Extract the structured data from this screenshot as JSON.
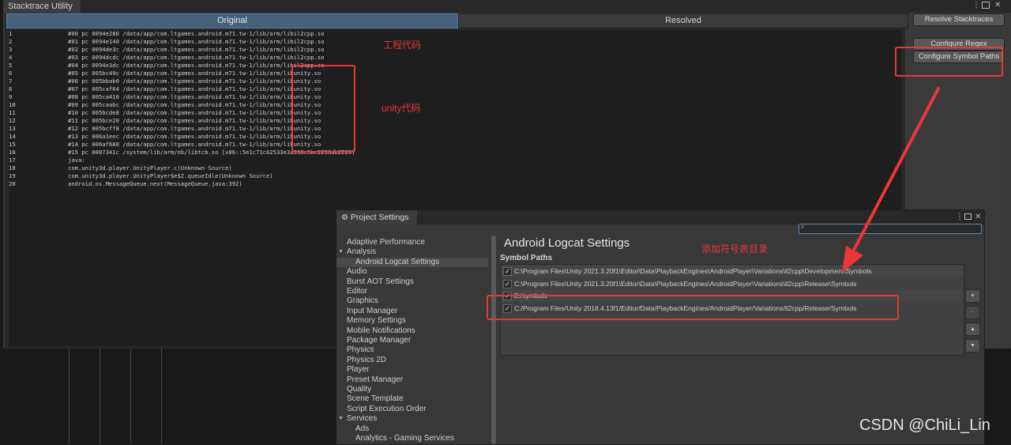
{
  "stacktrace_window": {
    "title": "Stacktrace Utility",
    "tabs": {
      "original": "Original",
      "resolved": "Resolved"
    },
    "lines": [
      {
        "n": "1",
        "text": "#00 pc 0094e280 /data/app/com.ltgames.android.m71.tw-1/lib/arm/libil2cpp.so"
      },
      {
        "n": "2",
        "text": "#01 pc 0094e140 /data/app/com.ltgames.android.m71.tw-1/lib/arm/libil2cpp.so"
      },
      {
        "n": "3",
        "text": "#02 pc 0094de3c /data/app/com.ltgames.android.m71.tw-1/lib/arm/libil2cpp.so"
      },
      {
        "n": "4",
        "text": "#03 pc 0094dcdc /data/app/com.ltgames.android.m71.tw-1/lib/arm/libil2cpp.so"
      },
      {
        "n": "5",
        "text": "#04 pc 0094e3dc /data/app/com.ltgames.android.m71.tw-1/lib/arm/libil2cpp.so"
      },
      {
        "n": "6",
        "text": "#05 pc 005bc49c /data/app/com.ltgames.android.m71.tw-1/lib/arm/libunity.so"
      },
      {
        "n": "7",
        "text": "#06 pc 005bbab0 /data/app/com.ltgames.android.m71.tw-1/lib/arm/libunity.so"
      },
      {
        "n": "8",
        "text": "#07 pc 005caf64 /data/app/com.ltgames.android.m71.tw-1/lib/arm/libunity.so"
      },
      {
        "n": "9",
        "text": "#08 pc 005ca410 /data/app/com.ltgames.android.m71.tw-1/lib/arm/libunity.so"
      },
      {
        "n": "10",
        "text": "#09 pc 005caabc /data/app/com.ltgames.android.m71.tw-1/lib/arm/libunity.so"
      },
      {
        "n": "11",
        "text": "#10 pc 005bcde8 /data/app/com.ltgames.android.m71.tw-1/lib/arm/libunity.so"
      },
      {
        "n": "12",
        "text": "#11 pc 005bce20 /data/app/com.ltgames.android.m71.tw-1/lib/arm/libunity.so"
      },
      {
        "n": "13",
        "text": "#12 pc 005bcff8 /data/app/com.ltgames.android.m71.tw-1/lib/arm/libunity.so"
      },
      {
        "n": "14",
        "text": "#13 pc 006a1eec /data/app/com.ltgames.android.m71.tw-1/lib/arm/libunity.so"
      },
      {
        "n": "15",
        "text": "#14 pc 006af680 /data/app/com.ltgames.android.m71.tw-1/lib/arm/libunity.so"
      },
      {
        "n": "16",
        "text": "#15 pc 0007341c /system/lib/arm/nb/libtcb.so [x86::5e1c71c62533e3a398c5bc2236db2226]"
      },
      {
        "n": "17",
        "text": "java:"
      },
      {
        "n": "18",
        "text": "com.unity3d.player.UnityPlayer.c(Unknown Source)"
      },
      {
        "n": "19",
        "text": "com.unity3d.player.UnityPlayer$e$2.queueIdle(Unknown Source)"
      },
      {
        "n": "20",
        "text": "android.os.MessageQueue.next(MessageQueue.java:392)"
      }
    ],
    "buttons": {
      "resolve": "Resolve Stacktraces",
      "regex": "Configure Regex",
      "symbol_paths": "Configure Symbol Paths"
    }
  },
  "annotations": {
    "project_code": "工程代码",
    "unity_code": "unity代码",
    "add_symbol_dir": "添加符号表目录"
  },
  "project_settings": {
    "title": "Project Settings",
    "gear_icon": "gear-icon",
    "sidebar": [
      {
        "label": "Adaptive Performance",
        "level": 0
      },
      {
        "label": "Analysis",
        "level": 0,
        "expanded": true
      },
      {
        "label": "Android Logcat Settings",
        "level": 1,
        "selected": true
      },
      {
        "label": "Audio",
        "level": 0
      },
      {
        "label": "Burst AOT Settings",
        "level": 0
      },
      {
        "label": "Editor",
        "level": 0
      },
      {
        "label": "Graphics",
        "level": 0
      },
      {
        "label": "Input Manager",
        "level": 0
      },
      {
        "label": "Memory Settings",
        "level": 0
      },
      {
        "label": "Mobile Notifications",
        "level": 0
      },
      {
        "label": "Package Manager",
        "level": 0
      },
      {
        "label": "Physics",
        "level": 0
      },
      {
        "label": "Physics 2D",
        "level": 0
      },
      {
        "label": "Player",
        "level": 0
      },
      {
        "label": "Preset Manager",
        "level": 0
      },
      {
        "label": "Quality",
        "level": 0
      },
      {
        "label": "Scene Template",
        "level": 0
      },
      {
        "label": "Script Execution Order",
        "level": 0
      },
      {
        "label": "Services",
        "level": 0,
        "expanded": true
      },
      {
        "label": "Ads",
        "level": 1
      },
      {
        "label": "Analytics - Gaming Services",
        "level": 1
      }
    ],
    "heading": "Android Logcat Settings",
    "symbol_paths_label": "Symbol Paths",
    "symbol_paths": [
      {
        "checked": true,
        "path": "C:\\Program Files\\Unity 2021.3.20f1\\Editor\\Data\\PlaybackEngines\\AndroidPlayer\\Variations\\il2cpp\\Development\\Symbols"
      },
      {
        "checked": true,
        "path": "C:\\Program Files\\Unity 2021.3.20f1\\Editor\\Data\\PlaybackEngines\\AndroidPlayer\\Variations\\il2cpp\\Release\\Symbols"
      },
      {
        "checked": true,
        "path": "E:/symbols"
      },
      {
        "checked": true,
        "path": "C:/Program Files/Unity 2018.4.13f1/Editor/Data/PlaybackEngines/AndroidPlayer/Variations/il2cpp/Release/Symbols"
      }
    ],
    "list_buttons": {
      "add": "+",
      "remove": "−",
      "up": "▲",
      "down": "▼"
    }
  },
  "watermark": "CSDN @ChiLi_Lin",
  "colors": {
    "annotation_red": "#e9373a",
    "selected_tab": "#46607c",
    "search_focus": "#5b89c0"
  }
}
